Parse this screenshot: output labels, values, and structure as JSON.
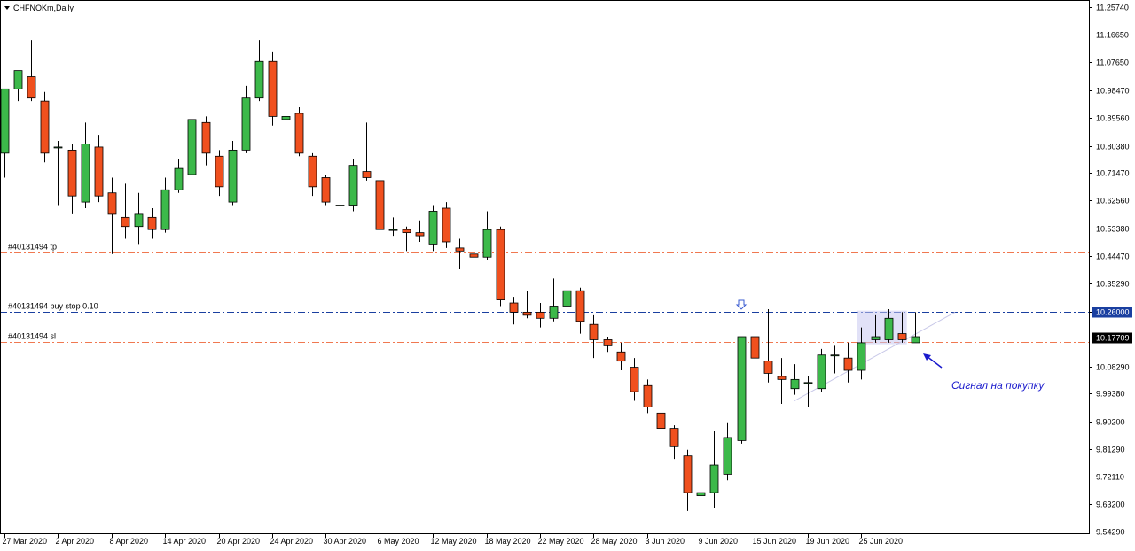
{
  "chart_data": {
    "type": "candlestick",
    "title": "CHFNOKm,Daily",
    "ylim": [
      9.5429,
      11.2574
    ],
    "y_ticks": [
      "11.25740",
      "11.16650",
      "11.07650",
      "10.98470",
      "10.89560",
      "10.80380",
      "10.71470",
      "10.62560",
      "10.53380",
      "10.44470",
      "10.35290",
      "10.26000",
      "10.17709",
      "10.08290",
      "9.99380",
      "9.90200",
      "9.81290",
      "9.72110",
      "9.63200",
      "9.54290"
    ],
    "x_ticks": [
      "27 Mar 2020",
      "2 Apr 2020",
      "8 Apr 2020",
      "14 Apr 2020",
      "20 Apr 2020",
      "24 Apr 2020",
      "30 Apr 2020",
      "6 May 2020",
      "12 May 2020",
      "18 May 2020",
      "22 May 2020",
      "28 May 2020",
      "3 Jun 2020",
      "9 Jun 2020",
      "15 Jun 2020",
      "19 Jun 2020",
      "25 Jun 2020"
    ],
    "x_tick_index": [
      0,
      4,
      8,
      12,
      16,
      20,
      24,
      28,
      32,
      36,
      40,
      44,
      48,
      52,
      56,
      60,
      64
    ],
    "colors": {
      "bull": "#3cb94a",
      "bear": "#f0501e",
      "wick": "#000000",
      "tp_line": "#f07850",
      "entry_line": "#1a3fa0",
      "price_line": "#9a9a9a",
      "signal": "#1a1acc",
      "box": "#c8c8f0"
    },
    "candles": [
      {
        "o": 10.78,
        "h": 10.96,
        "l": 10.7,
        "c": 10.99
      },
      {
        "o": 10.99,
        "h": 11.04,
        "l": 10.95,
        "c": 11.05
      },
      {
        "o": 11.03,
        "h": 11.15,
        "l": 10.95,
        "c": 10.96
      },
      {
        "o": 10.95,
        "h": 10.98,
        "l": 10.75,
        "c": 10.78
      },
      {
        "o": 10.8,
        "h": 10.82,
        "l": 10.61,
        "c": 10.8
      },
      {
        "o": 10.79,
        "h": 10.81,
        "l": 10.58,
        "c": 10.64
      },
      {
        "o": 10.62,
        "h": 10.88,
        "l": 10.6,
        "c": 10.81
      },
      {
        "o": 10.8,
        "h": 10.84,
        "l": 10.62,
        "c": 10.64
      },
      {
        "o": 10.65,
        "h": 10.7,
        "l": 10.45,
        "c": 10.58
      },
      {
        "o": 10.57,
        "h": 10.68,
        "l": 10.5,
        "c": 10.54
      },
      {
        "o": 10.54,
        "h": 10.65,
        "l": 10.48,
        "c": 10.58
      },
      {
        "o": 10.57,
        "h": 10.6,
        "l": 10.5,
        "c": 10.53
      },
      {
        "o": 10.53,
        "h": 10.7,
        "l": 10.52,
        "c": 10.66
      },
      {
        "o": 10.66,
        "h": 10.76,
        "l": 10.65,
        "c": 10.73
      },
      {
        "o": 10.71,
        "h": 10.91,
        "l": 10.7,
        "c": 10.89
      },
      {
        "o": 10.88,
        "h": 10.9,
        "l": 10.74,
        "c": 10.78
      },
      {
        "o": 10.77,
        "h": 10.79,
        "l": 10.64,
        "c": 10.67
      },
      {
        "o": 10.62,
        "h": 10.82,
        "l": 10.61,
        "c": 10.79
      },
      {
        "o": 10.79,
        "h": 11.0,
        "l": 10.78,
        "c": 10.96
      },
      {
        "o": 10.96,
        "h": 11.15,
        "l": 10.95,
        "c": 11.08
      },
      {
        "o": 11.08,
        "h": 11.11,
        "l": 10.87,
        "c": 10.9
      },
      {
        "o": 10.89,
        "h": 10.93,
        "l": 10.88,
        "c": 10.9
      },
      {
        "o": 10.91,
        "h": 10.93,
        "l": 10.77,
        "c": 10.78
      },
      {
        "o": 10.77,
        "h": 10.78,
        "l": 10.64,
        "c": 10.67
      },
      {
        "o": 10.7,
        "h": 10.71,
        "l": 10.61,
        "c": 10.62
      },
      {
        "o": 10.61,
        "h": 10.66,
        "l": 10.58,
        "c": 10.61
      },
      {
        "o": 10.61,
        "h": 10.76,
        "l": 10.59,
        "c": 10.74
      },
      {
        "o": 10.72,
        "h": 10.88,
        "l": 10.69,
        "c": 10.7
      },
      {
        "o": 10.69,
        "h": 10.7,
        "l": 10.52,
        "c": 10.53
      },
      {
        "o": 10.53,
        "h": 10.57,
        "l": 10.51,
        "c": 10.53
      },
      {
        "o": 10.53,
        "h": 10.54,
        "l": 10.46,
        "c": 10.52
      },
      {
        "o": 10.52,
        "h": 10.56,
        "l": 10.49,
        "c": 10.51
      },
      {
        "o": 10.48,
        "h": 10.61,
        "l": 10.46,
        "c": 10.59
      },
      {
        "o": 10.6,
        "h": 10.62,
        "l": 10.47,
        "c": 10.49
      },
      {
        "o": 10.47,
        "h": 10.5,
        "l": 10.4,
        "c": 10.46
      },
      {
        "o": 10.45,
        "h": 10.48,
        "l": 10.43,
        "c": 10.44
      },
      {
        "o": 10.44,
        "h": 10.59,
        "l": 10.43,
        "c": 10.53
      },
      {
        "o": 10.53,
        "h": 10.54,
        "l": 10.28,
        "c": 10.3
      },
      {
        "o": 10.29,
        "h": 10.31,
        "l": 10.22,
        "c": 10.26
      },
      {
        "o": 10.26,
        "h": 10.33,
        "l": 10.24,
        "c": 10.25
      },
      {
        "o": 10.26,
        "h": 10.29,
        "l": 10.21,
        "c": 10.24
      },
      {
        "o": 10.24,
        "h": 10.37,
        "l": 10.23,
        "c": 10.28
      },
      {
        "o": 10.28,
        "h": 10.34,
        "l": 10.26,
        "c": 10.33
      },
      {
        "o": 10.33,
        "h": 10.34,
        "l": 10.19,
        "c": 10.23
      },
      {
        "o": 10.22,
        "h": 10.25,
        "l": 10.11,
        "c": 10.17
      },
      {
        "o": 10.17,
        "h": 10.18,
        "l": 10.13,
        "c": 10.15
      },
      {
        "o": 10.13,
        "h": 10.16,
        "l": 10.07,
        "c": 10.1
      },
      {
        "o": 10.08,
        "h": 10.11,
        "l": 9.97,
        "c": 10.0
      },
      {
        "o": 10.02,
        "h": 10.04,
        "l": 9.93,
        "c": 9.95
      },
      {
        "o": 9.93,
        "h": 9.95,
        "l": 9.85,
        "c": 9.88
      },
      {
        "o": 9.88,
        "h": 9.89,
        "l": 9.78,
        "c": 9.82
      },
      {
        "o": 9.79,
        "h": 9.81,
        "l": 9.61,
        "c": 9.67
      },
      {
        "o": 9.66,
        "h": 9.7,
        "l": 9.61,
        "c": 9.67
      },
      {
        "o": 9.67,
        "h": 9.87,
        "l": 9.62,
        "c": 9.76
      },
      {
        "o": 9.73,
        "h": 9.9,
        "l": 9.71,
        "c": 9.85
      },
      {
        "o": 9.84,
        "h": 10.18,
        "l": 9.83,
        "c": 10.18
      },
      {
        "o": 10.18,
        "h": 10.27,
        "l": 10.05,
        "c": 10.11
      },
      {
        "o": 10.1,
        "h": 10.27,
        "l": 10.03,
        "c": 10.06
      },
      {
        "o": 10.05,
        "h": 10.11,
        "l": 9.96,
        "c": 10.04
      },
      {
        "o": 10.01,
        "h": 10.09,
        "l": 9.99,
        "c": 10.04
      },
      {
        "o": 10.03,
        "h": 10.05,
        "l": 9.95,
        "c": 10.03
      },
      {
        "o": 10.01,
        "h": 10.14,
        "l": 10.0,
        "c": 10.12
      },
      {
        "o": 10.12,
        "h": 10.15,
        "l": 10.06,
        "c": 10.12
      },
      {
        "o": 10.11,
        "h": 10.16,
        "l": 10.03,
        "c": 10.07
      },
      {
        "o": 10.07,
        "h": 10.21,
        "l": 10.04,
        "c": 10.16
      },
      {
        "o": 10.17,
        "h": 10.25,
        "l": 10.16,
        "c": 10.18
      },
      {
        "o": 10.17,
        "h": 10.27,
        "l": 10.16,
        "c": 10.24
      },
      {
        "o": 10.19,
        "h": 10.26,
        "l": 10.16,
        "c": 10.17
      },
      {
        "o": 10.16,
        "h": 10.26,
        "l": 10.16,
        "c": 10.18
      }
    ],
    "levels": [
      {
        "label": "#40131494 tp",
        "value": 10.4548,
        "style": "dashdot",
        "color": "tp"
      },
      {
        "label": "#40131494 buy stop 0.10",
        "value": 10.26,
        "style": "dashdot",
        "color": "entry"
      },
      {
        "label": "#40131494 sl",
        "value": 10.1637,
        "style": "dashdot",
        "color": "tp"
      }
    ],
    "price_label": "10.17709",
    "price_value": 10.17709,
    "entry_label": "10.26000",
    "annotation": "Сигнал на покупку"
  }
}
